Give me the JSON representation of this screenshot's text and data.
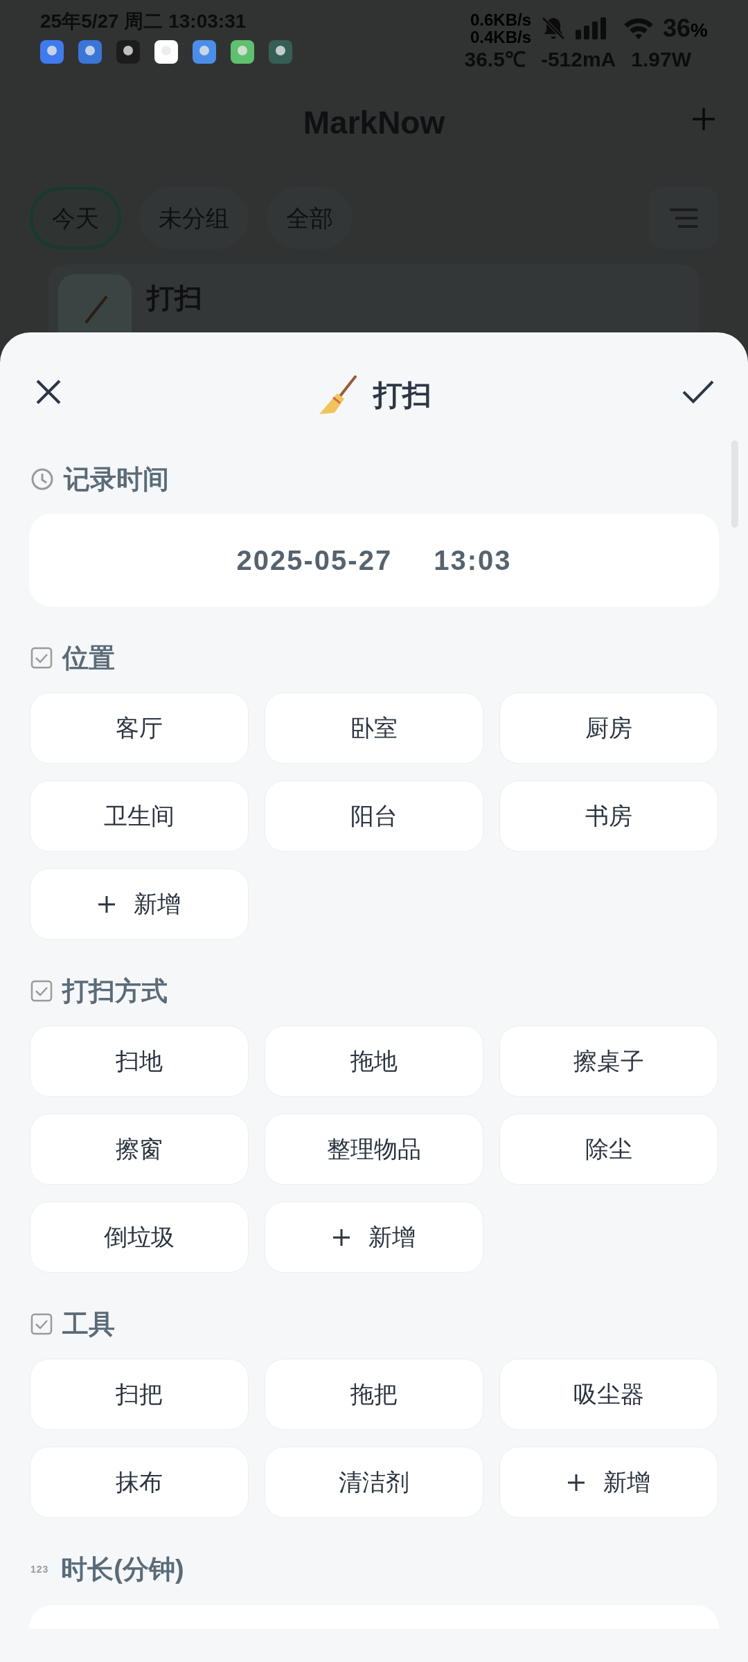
{
  "status_bar": {
    "datetime": "25年5/27 周二 13:03:31",
    "net_up": "0.6KB/s",
    "net_down": "0.4KB/s",
    "battery": "36",
    "battery_unit": "%",
    "temperature": "36.5℃",
    "current": "-512mA",
    "power": "1.97W"
  },
  "app": {
    "title": "MarkNow",
    "filters": [
      {
        "label": "今天",
        "selected": true
      },
      {
        "label": "未分组",
        "selected": false
      },
      {
        "label": "全部",
        "selected": false
      }
    ],
    "card_title": "打扫"
  },
  "sheet": {
    "title": "打扫",
    "record_time": {
      "label": "记录时间",
      "date": "2025-05-27",
      "time": "13:03"
    },
    "sections": [
      {
        "label": "位置",
        "options": [
          "客厅",
          "卧室",
          "厨房",
          "卫生间",
          "阳台",
          "书房"
        ],
        "add_label": "新增"
      },
      {
        "label": "打扫方式",
        "options": [
          "扫地",
          "拖地",
          "擦桌子",
          "擦窗",
          "整理物品",
          "除尘",
          "倒垃圾"
        ],
        "add_label": "新增"
      },
      {
        "label": "工具",
        "options": [
          "扫把",
          "拖把",
          "吸尘器",
          "抹布",
          "清洁剂"
        ],
        "add_label": "新增"
      }
    ],
    "duration": {
      "icon_text": "123",
      "label": "时长(分钟)"
    }
  }
}
